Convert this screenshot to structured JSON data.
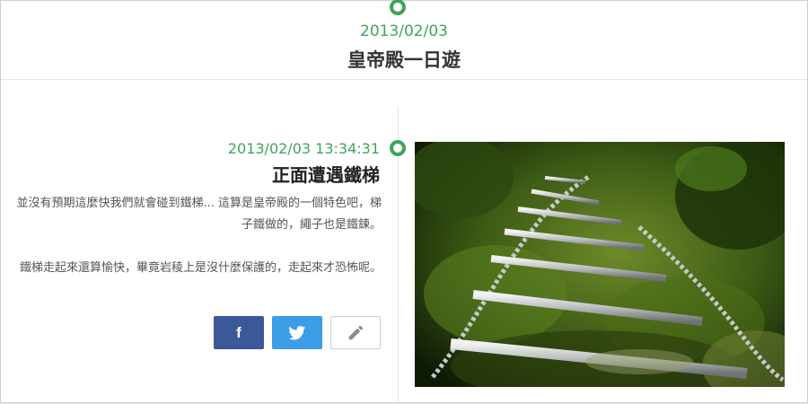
{
  "header": {
    "date": "2013/02/03",
    "title": "皇帝殿一日遊"
  },
  "entry": {
    "time": "2013/02/03 13:34:31",
    "title": "正面遭遇鐵梯",
    "paragraphs": [
      "並沒有預期這麼快我們就會碰到鐵梯... 這算是皇帝殿的一個特色吧，梯子鐵做的，繩子也是鐵鍊。",
      "鐵梯走起來還算愉快，畢竟岩稜上是沒什麼保護的，走起來才恐怖呢。"
    ]
  },
  "share": {
    "facebook_label": "f",
    "facebook_color": "#3b5998",
    "twitter_color": "#3d9de7",
    "twitter_icon": "twitter-bird-icon",
    "edit_icon": "pencil-icon"
  },
  "colors": {
    "accent": "#3fa45b"
  }
}
